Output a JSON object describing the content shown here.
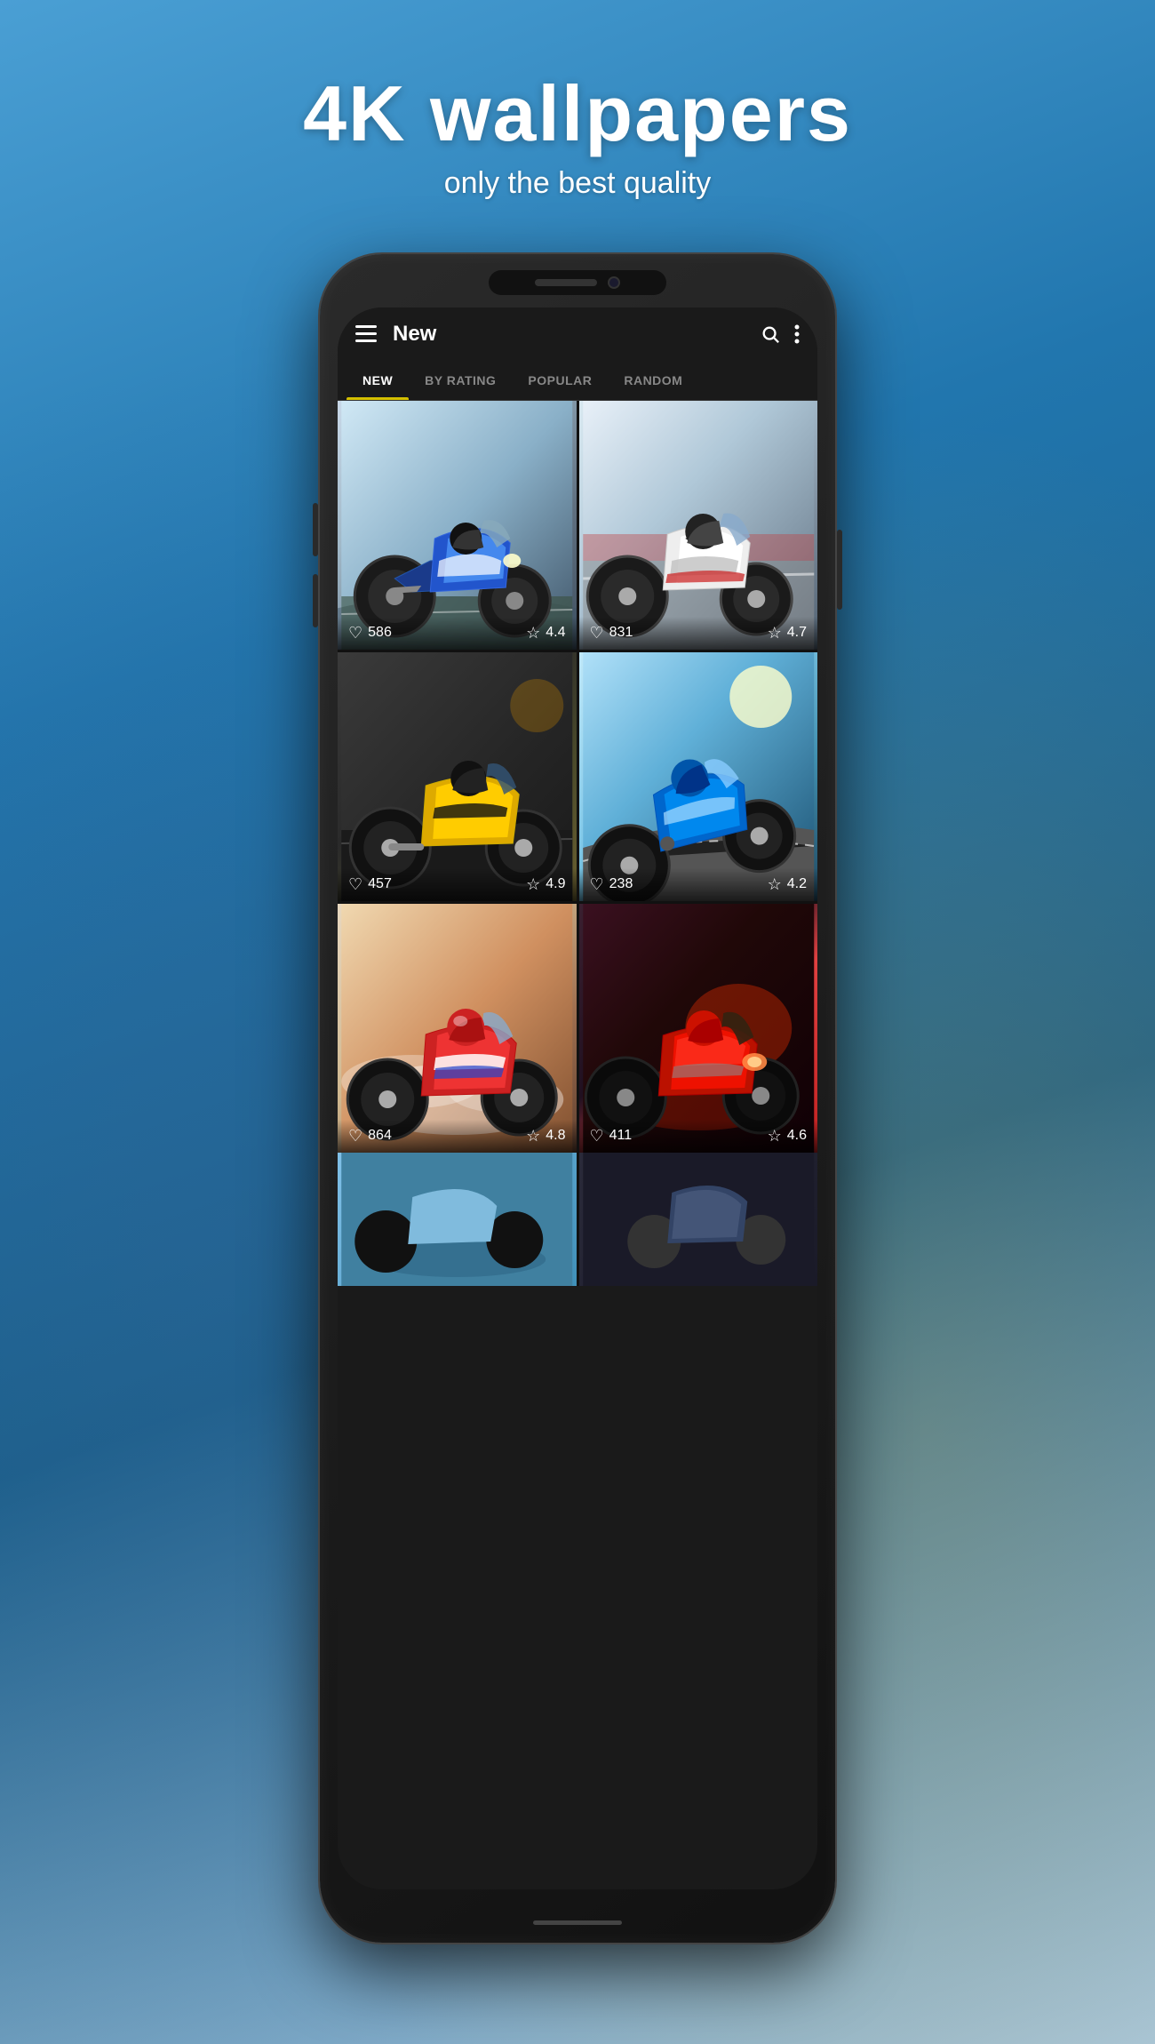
{
  "page": {
    "background_title": "4K wallpapers",
    "background_subtitle": "only the best quality"
  },
  "app": {
    "title": "New",
    "tabs": [
      {
        "id": "new",
        "label": "NEW",
        "active": true
      },
      {
        "id": "by_rating",
        "label": "BY RATING",
        "active": false
      },
      {
        "id": "popular",
        "label": "POPULAR",
        "active": false
      },
      {
        "id": "random",
        "label": "RANDOM",
        "active": false
      }
    ],
    "wallpapers": [
      {
        "id": 1,
        "likes": "586",
        "rating": "4.4",
        "bg_class": "moto-1"
      },
      {
        "id": 2,
        "likes": "831",
        "rating": "4.7",
        "bg_class": "moto-2"
      },
      {
        "id": 3,
        "likes": "457",
        "rating": "4.9",
        "bg_class": "moto-3"
      },
      {
        "id": 4,
        "likes": "238",
        "rating": "4.2",
        "bg_class": "moto-4"
      },
      {
        "id": 5,
        "likes": "864",
        "rating": "4.8",
        "bg_class": "moto-5"
      },
      {
        "id": 6,
        "likes": "411",
        "rating": "4.6",
        "bg_class": "moto-6"
      }
    ]
  },
  "icons": {
    "hamburger": "☰",
    "search": "🔍",
    "more": "⋮",
    "heart": "♡",
    "star": "☆"
  }
}
